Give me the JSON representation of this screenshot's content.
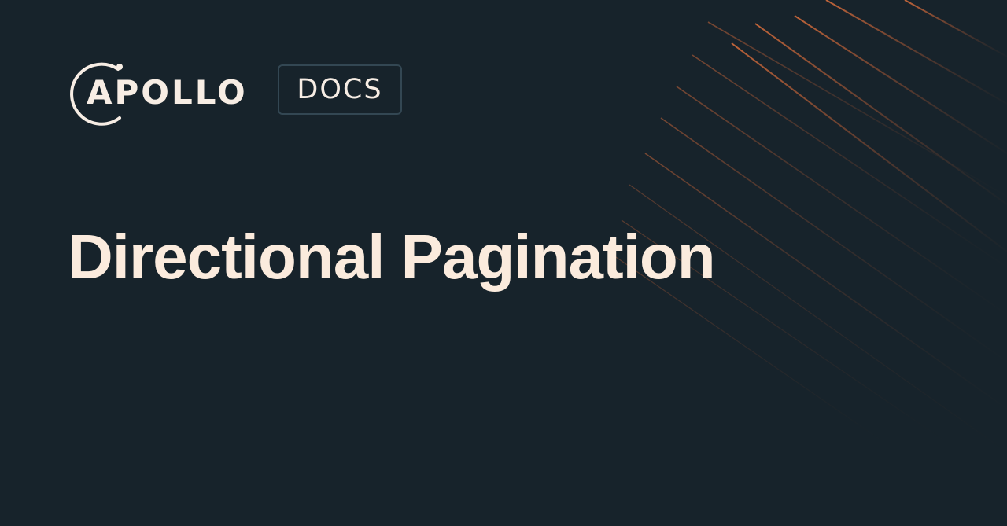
{
  "brand": {
    "logo_text": "APOLLO",
    "section_badge": "DOCS"
  },
  "page": {
    "title": "Directional Pagination"
  },
  "colors": {
    "background": "#17232b",
    "text": "#fbebdd",
    "badge_border": "#334753",
    "accent_lines": "#c8673a"
  }
}
